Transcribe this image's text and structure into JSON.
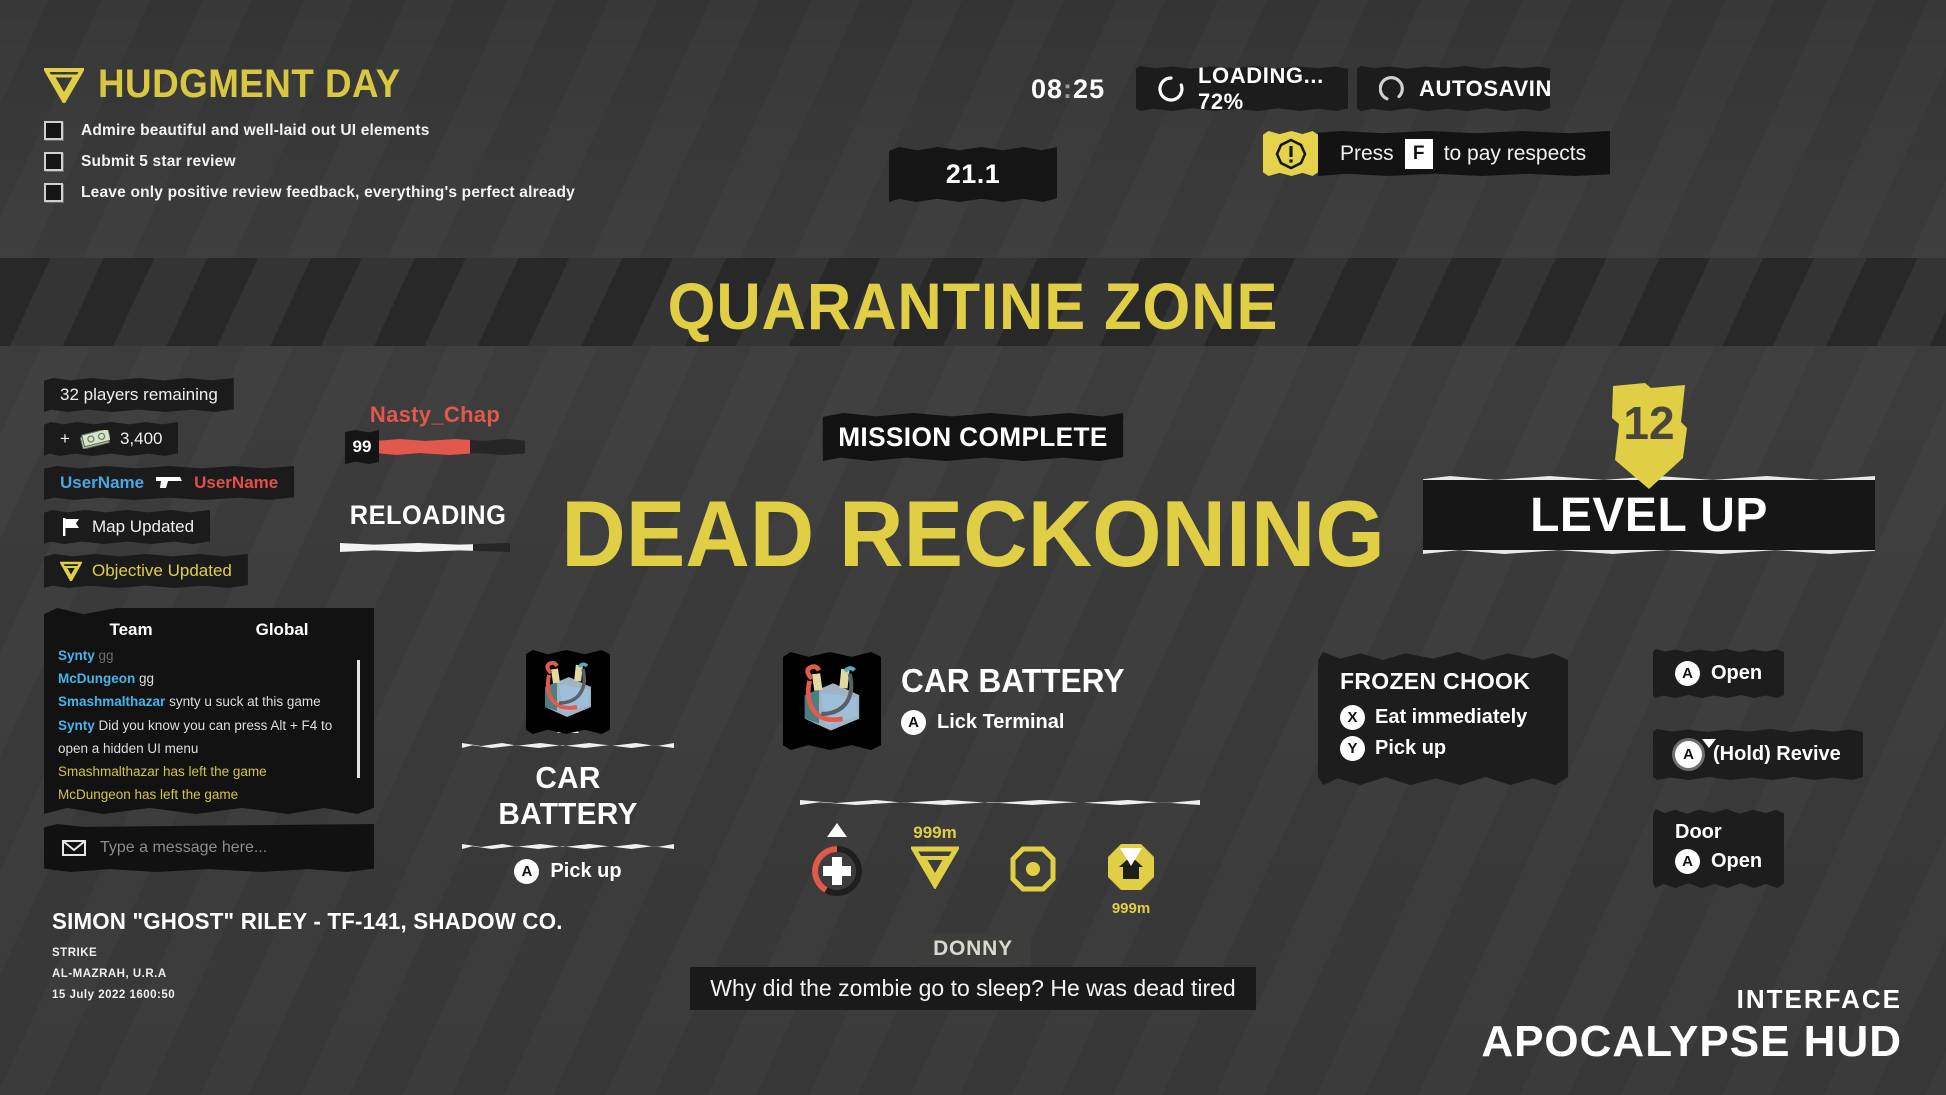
{
  "objective": {
    "title": "HUDGMENT DAY",
    "icon": "objective-triangle-icon",
    "items": [
      "Admire beautiful and well-laid out UI elements",
      "Submit 5 star review",
      "Leave only positive review feedback, everything's perfect already"
    ]
  },
  "clock": {
    "hours": "08",
    "sep": ":",
    "minutes": "25"
  },
  "status": {
    "loading": "LOADING... 72%",
    "autosaving": "AUTOSAVING..."
  },
  "respects": {
    "pre": "Press",
    "key": "F",
    "post": "to pay respects"
  },
  "damage_number": "21.1",
  "zone_title": "QUARANTINE ZONE",
  "notifications": [
    {
      "type": "text",
      "text": "32 players remaining"
    },
    {
      "type": "money",
      "prefix": "+",
      "amount": "3,400"
    },
    {
      "type": "kill",
      "killer": "UserName",
      "victim": "UserName"
    },
    {
      "type": "map",
      "text": "Map Updated"
    },
    {
      "type": "objective",
      "text": "Objective Updated"
    }
  ],
  "enemy": {
    "name": "Nasty_Chap",
    "level": "99",
    "health_percent": 62
  },
  "reloading": {
    "label": "RELOADING",
    "progress_percent": 78
  },
  "mission": {
    "badge": "MISSION COMPLETE",
    "title": "DEAD RECKONING"
  },
  "level_up": {
    "level": "12",
    "label": "LEVEL UP"
  },
  "chat": {
    "tabs": [
      "Team",
      "Global"
    ],
    "messages": [
      {
        "name": "Synty",
        "text": "gg",
        "style": "faded"
      },
      {
        "name": "McDungeon",
        "text": "gg",
        "style": "player"
      },
      {
        "name": "Smashmalthazar",
        "text": "synty u suck at this game",
        "style": "player"
      },
      {
        "name": "Synty",
        "text": "Did you know you can press Alt + F4 to open a hidden UI menu",
        "style": "player"
      },
      {
        "name": "",
        "text": "Smashmalthazar has left the game",
        "style": "system"
      },
      {
        "name": "",
        "text": "McDungeon has left the game",
        "style": "system"
      }
    ],
    "input_placeholder": "Type a message here...",
    "input_value": "",
    "input_icon": "envelope-icon"
  },
  "operator": {
    "name": "SIMON \"GHOST\" RILEY - TF-141, SHADOW CO.",
    "mode": "STRIKE",
    "location": "AL-MAZRAH, U.R.A",
    "timestamp": "15 July 2022 1600:50"
  },
  "pickup_card": {
    "name": "CAR BATTERY",
    "button": "A",
    "action": "Pick up",
    "thumb": "car-battery-icon"
  },
  "interact": {
    "name": "CAR BATTERY",
    "button": "A",
    "action": "Lick Terminal",
    "thumb": "car-battery-icon"
  },
  "compass": {
    "markers": [
      {
        "icon": "health-cross-icon",
        "distance": ""
      },
      {
        "icon": "objective-triangle-icon",
        "distance": "999m",
        "position": "above"
      },
      {
        "icon": "loot-octagon-icon",
        "distance": ""
      },
      {
        "icon": "home-icon",
        "distance": "999m",
        "position": "below"
      }
    ]
  },
  "chook_prompt": {
    "title": "FROZEN CHOOK",
    "options": [
      {
        "button": "X",
        "label": "Eat immediately"
      },
      {
        "button": "Y",
        "label": "Pick up"
      }
    ]
  },
  "prompts": [
    {
      "id": "open",
      "button": "A",
      "label": "Open"
    },
    {
      "id": "revive",
      "button": "A",
      "label": "(Hold) Revive",
      "hold": true
    },
    {
      "id": "door",
      "name": "Door",
      "button": "A",
      "label": "Open"
    }
  ],
  "subtitle": {
    "speaker": "DONNY",
    "text": "Why did the zombie go to sleep?  He was dead tired"
  },
  "brand": {
    "line1": "INTERFACE",
    "line2": "APOCALYPSE HUD"
  },
  "colors": {
    "accent": "#e0cf45",
    "danger": "#e1584d",
    "player": "#46b4ea",
    "panel": "#1c1c1c"
  }
}
